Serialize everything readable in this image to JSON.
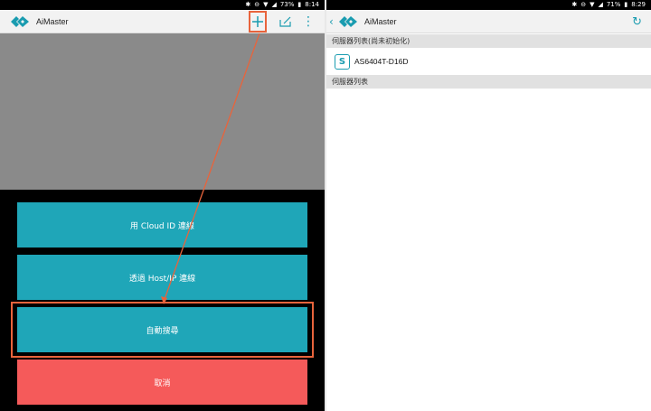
{
  "left_screen": {
    "status_bar": {
      "battery": "73%",
      "time": "8:14"
    },
    "app_bar": {
      "title": "AiMaster"
    },
    "buttons": {
      "cloud_id": "用 Cloud ID 連線",
      "host_ip": "透過 Host/IP 連線",
      "auto_search": "自動搜尋",
      "cancel": "取消"
    }
  },
  "right_screen": {
    "status_bar": {
      "battery": "71%",
      "time": "8:29"
    },
    "app_bar": {
      "title": "AiMaster"
    },
    "sections": {
      "uninitialized": "伺服器列表(尚未初始化)",
      "servers": "伺服器列表"
    },
    "server": {
      "name": "AS6404T-D16D"
    }
  },
  "colors": {
    "accent": "#1fa6b8",
    "cancel": "#f55a5a",
    "annotation": "#e8643c"
  }
}
